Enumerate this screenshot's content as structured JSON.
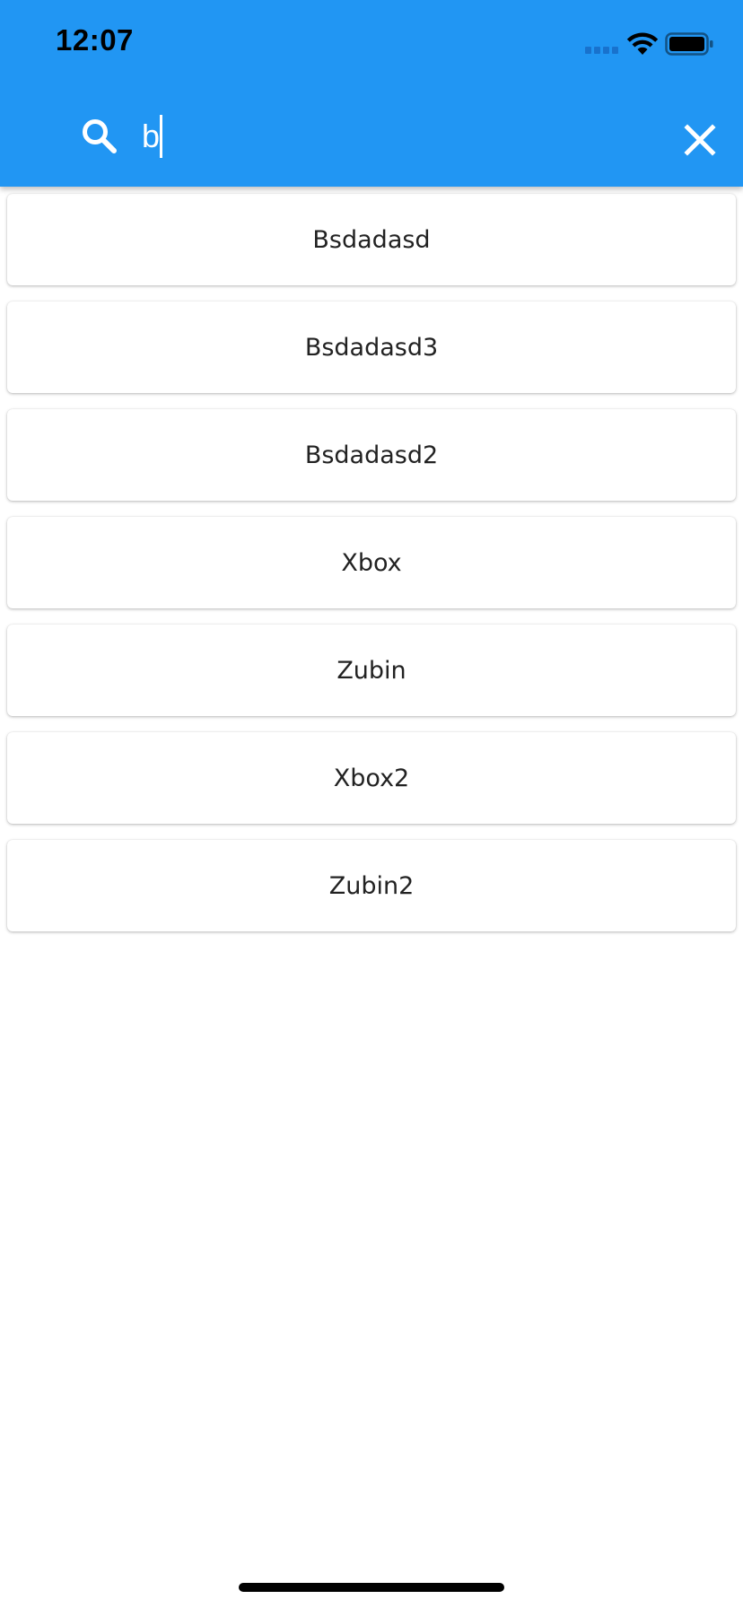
{
  "status_bar": {
    "time": "12:07"
  },
  "search": {
    "value": "b",
    "placeholder": "",
    "search_icon": "search-icon",
    "close_icon": "close-icon"
  },
  "results": [
    {
      "label": "Bsdadasd"
    },
    {
      "label": "Bsdadasd3"
    },
    {
      "label": "Bsdadasd2"
    },
    {
      "label": "Xbox"
    },
    {
      "label": "Zubin"
    },
    {
      "label": "Xbox2"
    },
    {
      "label": "Zubin2"
    }
  ],
  "colors": {
    "app_bar": "#2196F3",
    "card_background": "#FFFFFF",
    "text": "#222222"
  }
}
